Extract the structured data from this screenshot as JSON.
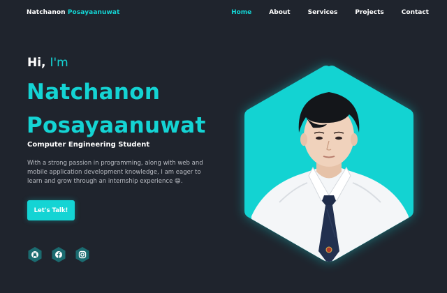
{
  "nav": {
    "logo_first": "Natchanon",
    "logo_second": "Posayaanuwat",
    "items": [
      {
        "label": "Home",
        "active": true
      },
      {
        "label": "About",
        "active": false
      },
      {
        "label": "Services",
        "active": false
      },
      {
        "label": "Projects",
        "active": false
      },
      {
        "label": "Contact",
        "active": false
      }
    ]
  },
  "hero": {
    "greeting_prefix": "Hi,",
    "greeting_accent": "I'm",
    "name_line1": "Natchanon",
    "name_line2": "Posayaanuwat",
    "role": "Computer Engineering Student",
    "description": "With a strong passion in programming, along with web and mobile application development knowledge, I am eager to learn and grow through an internship experience 😁.",
    "cta_label": "Let's Talk!",
    "socials": [
      {
        "icon": "github-icon"
      },
      {
        "icon": "facebook-icon"
      },
      {
        "icon": "instagram-icon"
      }
    ]
  },
  "colors": {
    "background": "#1f242d",
    "accent": "#14d4d4",
    "text": "#ffffff",
    "muted": "#b9bcc3"
  }
}
